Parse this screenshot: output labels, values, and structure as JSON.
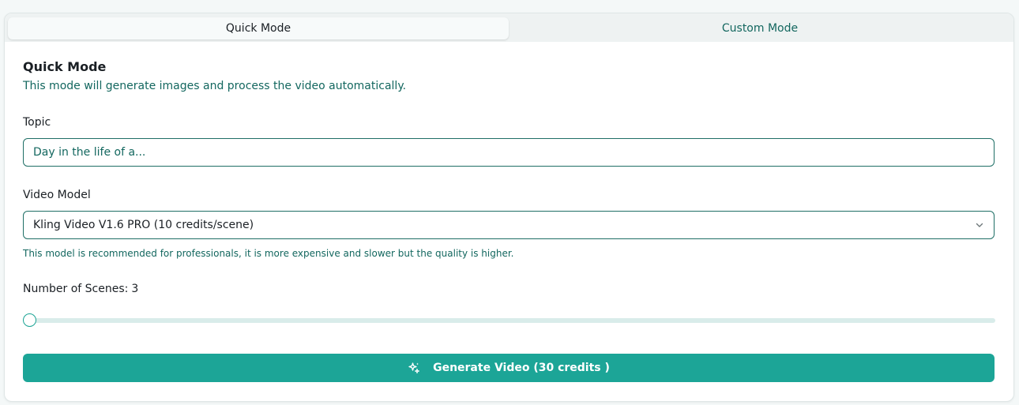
{
  "tabs": {
    "quick": "Quick Mode",
    "custom": "Custom Mode",
    "active": "Quick Mode"
  },
  "section": {
    "title": "Quick Mode",
    "description": "This mode will generate images and process the video automatically."
  },
  "topic": {
    "label": "Topic",
    "placeholder": "Day in the life of a...",
    "value": ""
  },
  "video_model": {
    "label": "Video Model",
    "selected": "Kling Video V1.6 PRO (10 credits/scene)",
    "helper": "This model is recommended for professionals, it is more expensive and slower but the quality is higher.",
    "chevron_icon": "chevron-down-icon"
  },
  "scenes": {
    "label": "Number of Scenes:",
    "count": "3",
    "slider_level_fraction": 0
  },
  "generate": {
    "label": "Generate Video (30 credits )",
    "icon": "sparkle-icon"
  },
  "colors": {
    "accent": "#1ca597",
    "accent_text": "#13675f",
    "track": "#d9ecea",
    "tabbar": "#eef2f2"
  }
}
